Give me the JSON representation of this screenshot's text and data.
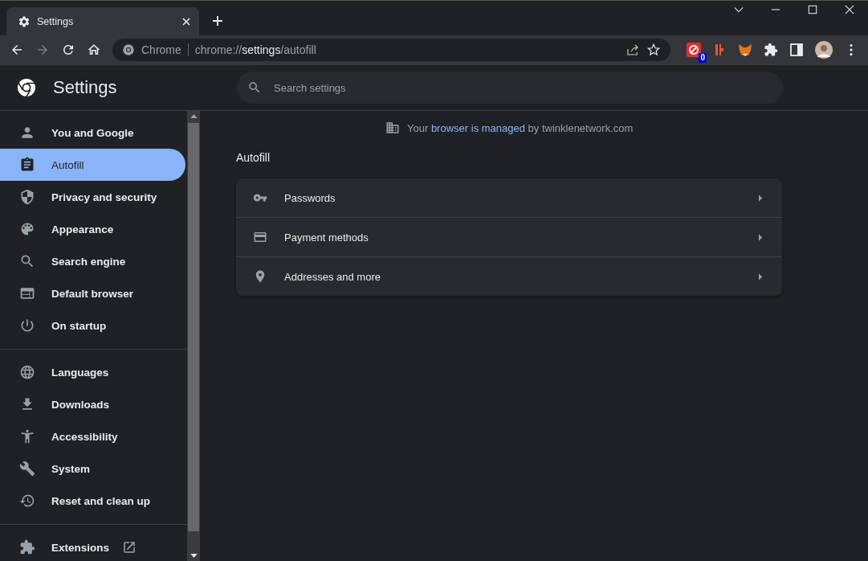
{
  "browser": {
    "tab": {
      "title": "Settings",
      "selected": true
    },
    "nav_buttons": [
      {
        "kind": "back",
        "disabled": false
      },
      {
        "kind": "forward",
        "disabled": true
      },
      {
        "kind": "reload",
        "disabled": false
      },
      {
        "kind": "home",
        "disabled": false
      }
    ],
    "omnibox": {
      "site_label": "Chrome",
      "url_scheme": "chrome://",
      "url_host": "settings",
      "url_path": "/autofill"
    },
    "extension_badge": "0"
  },
  "header": {
    "title": "Settings",
    "search": {
      "placeholder": "Search settings"
    }
  },
  "sidebar": {
    "groups": [
      [
        {
          "label": "You and Google",
          "selected": false,
          "kind": "page"
        },
        {
          "label": "Autofill",
          "selected": true,
          "kind": "page"
        },
        {
          "label": "Privacy and security",
          "selected": false,
          "kind": "page"
        },
        {
          "label": "Appearance",
          "selected": false,
          "kind": "page"
        },
        {
          "label": "Search engine",
          "selected": false,
          "kind": "page"
        },
        {
          "label": "Default browser",
          "selected": false,
          "kind": "page"
        },
        {
          "label": "On startup",
          "selected": false,
          "kind": "page"
        }
      ],
      [
        {
          "label": "Languages",
          "selected": false,
          "kind": "page"
        },
        {
          "label": "Downloads",
          "selected": false,
          "kind": "page"
        },
        {
          "label": "Accessibility",
          "selected": false,
          "kind": "page"
        },
        {
          "label": "System",
          "selected": false,
          "kind": "page"
        },
        {
          "label": "Reset and clean up",
          "selected": false,
          "kind": "page"
        }
      ],
      [
        {
          "label": "Extensions",
          "selected": false,
          "kind": "external"
        }
      ]
    ]
  },
  "managed_notice": {
    "prefix": "Your",
    "link": "browser is managed",
    "suffix": "by twinklenetwork.com"
  },
  "section": {
    "title": "Autofill",
    "rows": [
      {
        "label": "Passwords"
      },
      {
        "label": "Payment methods"
      },
      {
        "label": "Addresses and more"
      }
    ]
  }
}
